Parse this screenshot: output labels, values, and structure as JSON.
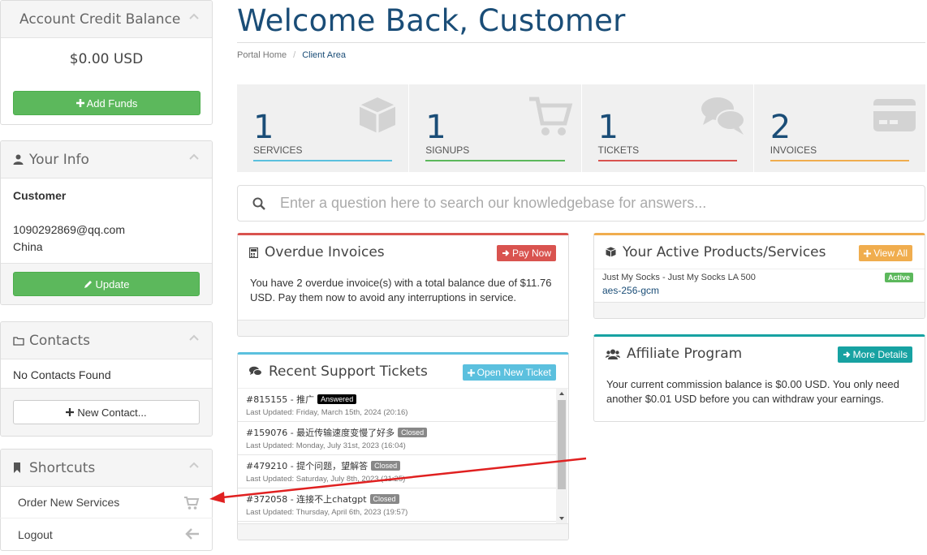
{
  "sidebar": {
    "credit": {
      "title": "Account Credit Balance",
      "balance": "$0.00 USD",
      "add_funds_label": "Add Funds"
    },
    "your_info": {
      "title": "Your Info",
      "name": "Customer",
      "email": "1090292869@qq.com",
      "country": "China",
      "update_label": "Update"
    },
    "contacts": {
      "title": "Contacts",
      "empty_text": "No Contacts Found",
      "new_contact_label": "New Contact..."
    },
    "shortcuts": {
      "title": "Shortcuts",
      "items": [
        {
          "label": "Order New Services",
          "icon": "cart-icon"
        },
        {
          "label": "Logout",
          "icon": "arrow-left-icon"
        }
      ]
    }
  },
  "header": {
    "title": "Welcome Back, Customer",
    "breadcrumb": [
      "Portal Home",
      "Client Area"
    ]
  },
  "stats": [
    {
      "count": "1",
      "label": "SERVICES",
      "color": "#5bc0de",
      "icon": "cube-icon"
    },
    {
      "count": "1",
      "label": "SIGNUPS",
      "color": "#5cb85c",
      "icon": "cart-icon"
    },
    {
      "count": "1",
      "label": "TICKETS",
      "color": "#d9534f",
      "icon": "comments-icon"
    },
    {
      "count": "2",
      "label": "INVOICES",
      "color": "#f0ad4e",
      "icon": "credit-card-icon"
    }
  ],
  "search": {
    "placeholder": "Enter a question here to search our knowledgebase for answers..."
  },
  "overdue": {
    "title": "Overdue Invoices",
    "button": "Pay Now",
    "text": "You have 2 overdue invoice(s) with a total balance due of $11.76 USD. Pay them now to avoid any interruptions in service.",
    "color": "#d9534f"
  },
  "tickets": {
    "title": "Recent Support Tickets",
    "button": "Open New Ticket",
    "color": "#5bc0de",
    "items": [
      {
        "subject": "#815155 - 推广",
        "status": "Answered",
        "status_color": "#000000",
        "updated": "Last Updated: Friday, March 15th, 2024 (20:16)"
      },
      {
        "subject": "#159076 - 最近传输速度变慢了好多",
        "status": "Closed",
        "status_color": "#888888",
        "updated": "Last Updated: Monday, July 31st, 2023 (16:04)"
      },
      {
        "subject": "#479210 - 提个问题，望解答",
        "status": "Closed",
        "status_color": "#888888",
        "updated": "Last Updated: Saturday, July 8th, 2023 (21:25)"
      },
      {
        "subject": "#372058 - 连接不上chatgpt",
        "status": "Closed",
        "status_color": "#888888",
        "updated": "Last Updated: Thursday, April 6th, 2023 (19:57)"
      }
    ]
  },
  "products": {
    "title": "Your Active Products/Services",
    "button": "View All",
    "color": "#f0ad4e",
    "items": [
      {
        "name": "Just My Socks - Just My Socks LA 500",
        "detail": "aes-256-gcm",
        "status": "Active",
        "status_color": "#5cb85c"
      }
    ]
  },
  "affiliate": {
    "title": "Affiliate Program",
    "button": "More Details",
    "color": "#17a2a2",
    "text": "Your current commission balance is $0.00 USD. You only need another $0.01 USD before you can withdraw your earnings."
  }
}
